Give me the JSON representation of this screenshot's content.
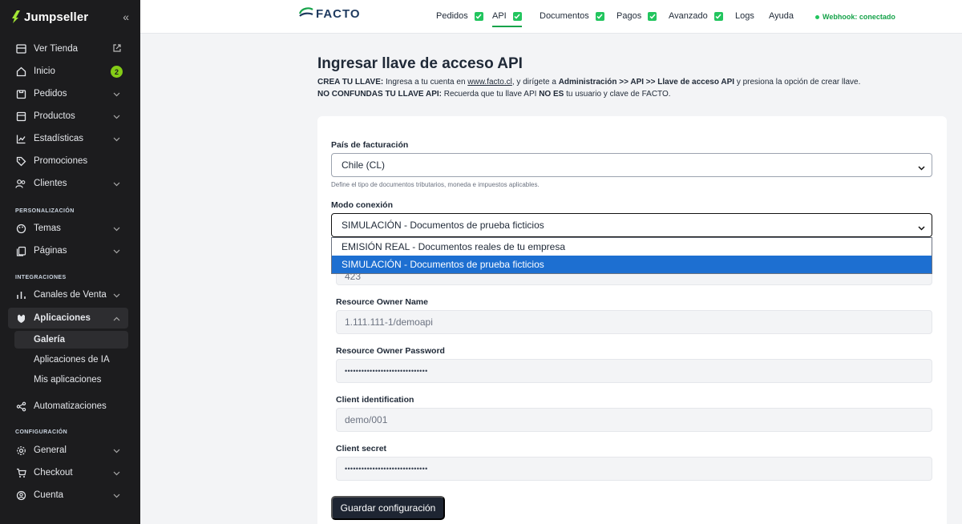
{
  "sidebar": {
    "brand": "Jumpseller",
    "items": {
      "ver_tienda": "Ver Tienda",
      "inicio": "Inicio",
      "inicio_badge": "2",
      "pedidos": "Pedidos",
      "productos": "Productos",
      "estadisticas": "Estadísticas",
      "promociones": "Promociones",
      "clientes": "Clientes",
      "temas": "Temas",
      "paginas": "Páginas",
      "canales": "Canales de Venta",
      "aplicaciones": "Aplicaciones",
      "galeria": "Galería",
      "apps_ia": "Aplicaciones de IA",
      "mis_apps": "Mis aplicaciones",
      "automatizaciones": "Automatizaciones",
      "general": "General",
      "checkout": "Checkout",
      "cuenta": "Cuenta"
    },
    "sections": {
      "personalizacion": "PERSONALIZACIÓN",
      "integraciones": "INTEGRACIONES",
      "configuracion": "CONFIGURACIÓN"
    }
  },
  "topbar": {
    "logo": "FACTO",
    "tabs": {
      "pedidos": "Pedidos",
      "api": "API",
      "documentos": "Documentos",
      "pagos": "Pagos",
      "avanzado": "Avanzado",
      "logs": "Logs",
      "ayuda": "Ayuda"
    },
    "webhook": "Webhook: conectado"
  },
  "main": {
    "title": "Ingresar llave de acceso API",
    "line1": {
      "b1": "CREA TU LLAVE:",
      "t1": " Ingresa a tu cuenta en ",
      "link": "www.facto.cl",
      "t2": ", y dirígete a ",
      "b2": "Administración >> API >> Llave de acceso API",
      "t3": " y presiona la opción de crear llave."
    },
    "line2": {
      "b1": "NO CONFUNDAS TU LLAVE API:",
      "t1": " Recuerda que tu llave API ",
      "b2": "NO ES",
      "t2": " tu usuario y clave de FACTO."
    },
    "form": {
      "pais_label": "País de facturación",
      "pais_value": "Chile (CL)",
      "pais_hint": "Define el tipo de documentos tributarios, moneda e impuestos aplicables.",
      "modo_label": "Modo conexión",
      "modo_value": "SIMULACIÓN - Documentos de prueba ficticios",
      "modo_options": [
        "EMISIÓN REAL - Documentos reales de tu empresa",
        "SIMULACIÓN - Documentos de prueba ficticios"
      ],
      "hidden_value": "423",
      "owner_name_label": "Resource Owner Name",
      "owner_name_value": "1.111.111-1/demoapi",
      "owner_pass_label": "Resource Owner Password",
      "owner_pass_value": "••••••••••••••••••••••••••••••",
      "client_id_label": "Client identification",
      "client_id_value": "demo/001",
      "client_secret_label": "Client secret",
      "client_secret_value": "••••••••••••••••••••••••••••••",
      "save_label": "Guardar configuración"
    }
  },
  "colors": {
    "sidebar_bg": "#1c1c1e",
    "accent_green": "#16a34a",
    "badge_green": "#84cc16",
    "selected_option": "#1d6fd1",
    "button_dark": "#1e2532"
  }
}
